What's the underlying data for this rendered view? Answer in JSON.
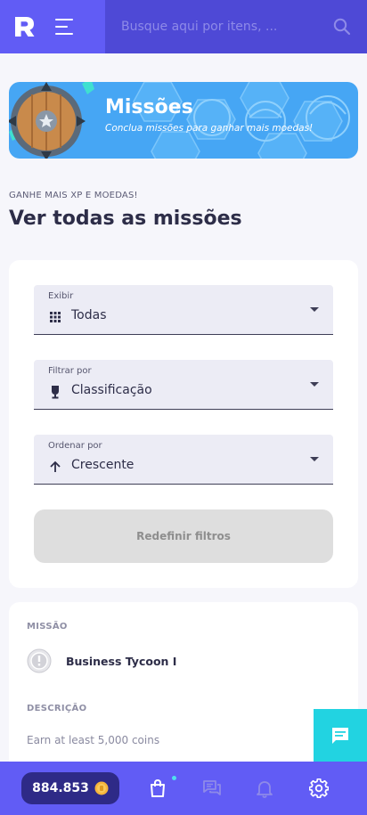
{
  "header": {
    "logo_icon": "r-logo-icon",
    "menu_icon": "hamburger-menu-icon",
    "search_placeholder": "Busque aqui por itens, ...",
    "search_icon": "search-icon"
  },
  "banner": {
    "title": "Missões",
    "subtitle": "Conclua missões para ganhar mais moedas!",
    "art_icon": "shield-icon"
  },
  "section": {
    "kicker": "GANHE MAIS XP E MOEDAS!",
    "title": "Ver todas as missões"
  },
  "filters": {
    "display": {
      "label": "Exibir",
      "value": "Todas",
      "icon": "grid-icon"
    },
    "filter_by": {
      "label": "Filtrar por",
      "value": "Classificação",
      "icon": "trophy-icon"
    },
    "order_by": {
      "label": "Ordenar por",
      "value": "Crescente",
      "icon": "arrow-up-icon"
    },
    "reset_label": "Redefinir filtros"
  },
  "mission": {
    "mission_header": "MISSÃO",
    "name": "Business Tycoon I",
    "badge_icon": "silver-medal-icon",
    "description_header": "DESCRIÇÃO",
    "description": "Earn at least 5,000 coins"
  },
  "chat": {
    "icon": "chat-icon"
  },
  "bottom_nav": {
    "coins": "884.853",
    "coin_icon": "coin-icon",
    "items": [
      "shopping-bag-icon",
      "messages-icon",
      "bell-icon",
      "gear-icon"
    ]
  },
  "colors": {
    "primary": "#615cf5",
    "primary_dark": "#4e49d6",
    "banner_blue": "#46a6f4",
    "chat_cyan": "#22d3e1",
    "coin_bg": "#2e2a87"
  }
}
